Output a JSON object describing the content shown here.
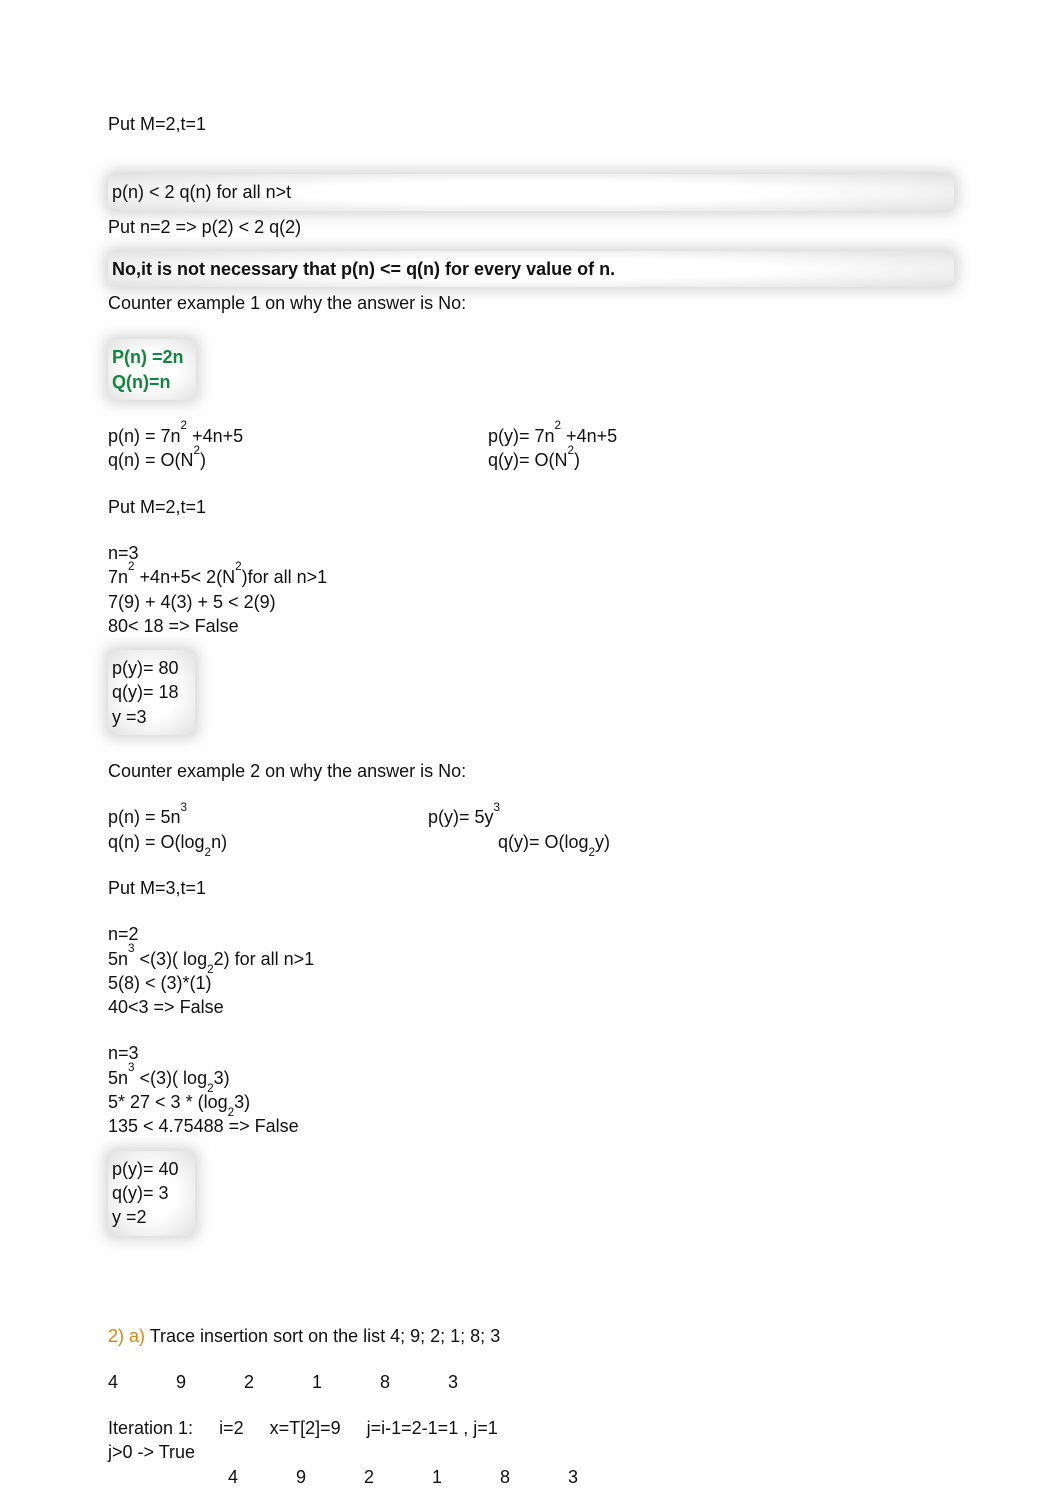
{
  "lines": {
    "l0": "Put M=2,t=1",
    "l1": "p(n) < 2 q(n) for all n>t",
    "l2": "Put n=2 => p(2) < 2 q(2)",
    "l3": "No,it is not necessary that p(n) <= q(n) for every value of n.",
    "l4": "Counter example 1 on why the answer is No:",
    "pn2n": "P(n) =2n",
    "qnn": "Q(n)=n",
    "pn_a": "p(n) = 7n",
    "pn_b": " +4n+5",
    "qn_a": "q(n) = O(N",
    "qn_b": ")",
    "py_a": "p(y)= 7n",
    "py_b": " +4n+5",
    "qy_a": "q(y)= O(N",
    "qy_b": ")",
    "l5": "Put M=2,t=1",
    "l6": "n=3",
    "l7a": "7n",
    "l7b": " +4n+5< 2(N",
    "l7c": ")for all n>1",
    "l8": "7(9) + 4(3) + 5 < 2(9)",
    "l9": "80< 18 => False",
    "py80": "p(y)= 80",
    "qy18": "q(y)= 18",
    "y3": "y =3",
    "ce2": "Counter example 2 on why the answer is No:",
    "pn5_a": "p(n) = 5n",
    "py5_a": "p(y)= 5y",
    "qnlog_a": "q(n) = O(log",
    "qnlog_b": "n)",
    "qylog_a": "q(y)= O(log",
    "qylog_b": "y)",
    "l10": "Put M=3,t=1",
    "l11": "n=2",
    "l12a": "5n",
    "l12b": " <(3)( log",
    "l12c": "2) for all n>1",
    "l13": "5(8) < (3)*(1)",
    "l14": "40<3 => False",
    "l15": "n=3",
    "l16a": "5n",
    "l16b": " <(3)( log",
    "l16c": "3)",
    "l17a": "5* 27 < 3 * (log",
    "l17b": "3)",
    "l18": "135 < 4.75488 => False",
    "py40": "p(y)= 40",
    "qy3": "q(y)= 3",
    "y2": "y =2",
    "q2label": "2) a)",
    "q2text": " Trace insertion sort on the list 4; 9; 2; 1; 8; 3",
    "iter1a": "Iteration 1:",
    "iter1b": "i=2",
    "iter1c": "x=T[2]=9",
    "iter1d": "j=i-1=2-1=1 , j=1",
    "jtrue": "j>0 -> True"
  },
  "sup2": "2",
  "sup3": "3",
  "sub2": "2",
  "arr": [
    "4",
    "9",
    "2",
    "1",
    "8",
    "3"
  ]
}
